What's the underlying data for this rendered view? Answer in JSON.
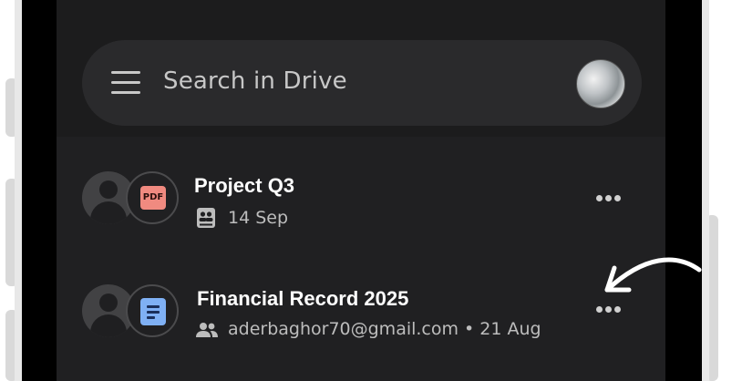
{
  "search": {
    "placeholder": "Search in Drive"
  },
  "icons": {
    "menu": "hamburger-menu-icon",
    "account": "account-avatar",
    "owner": "person-icon",
    "pdf": "pdf-file-icon",
    "doc": "docs-file-icon",
    "shared_drive": "shared-drive-icon",
    "shared_people": "people-icon",
    "more": "more-horizontal-icon"
  },
  "files": [
    {
      "title": "Project Q3",
      "badge": "PDF",
      "meta": "14 Sep"
    },
    {
      "title": "Financial Record 2025",
      "meta": "aderbaghor70@gmail.com • 21 Aug"
    }
  ],
  "colors": {
    "background": "#1f1f21",
    "search_bar": "#2a2a2c",
    "pdf": "#f08a80",
    "doc": "#7fb0f4"
  }
}
